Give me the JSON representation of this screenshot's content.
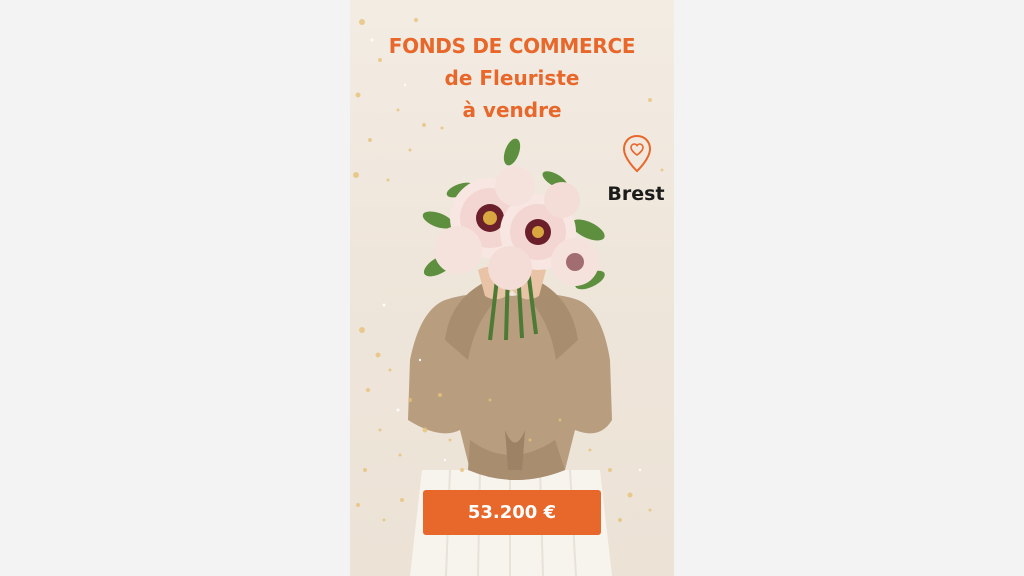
{
  "ad": {
    "headline_line1": "FONDS DE COMMERCE",
    "headline_line2": "de Fleuriste",
    "headline_line3": "à vendre",
    "location": "Brest",
    "price": "53.200 €"
  },
  "colors": {
    "accent": "#e8672a",
    "location_text": "#1b1b1b",
    "background": "#efe6db"
  },
  "icons": {
    "location": "heart-location-pin-icon"
  }
}
